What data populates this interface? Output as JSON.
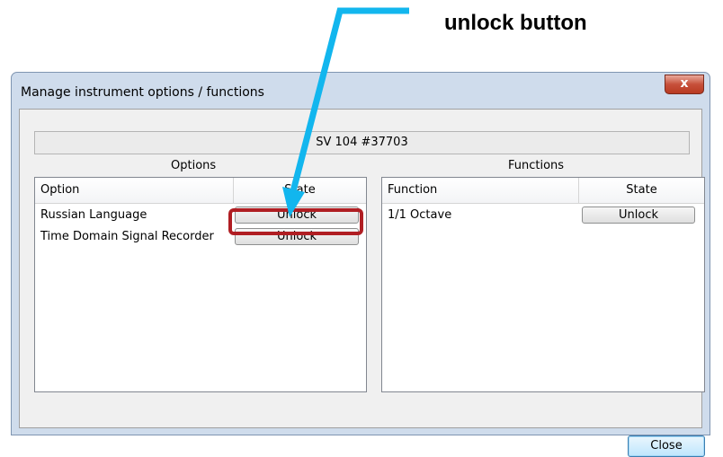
{
  "annotation": {
    "label": "unlock button"
  },
  "window": {
    "title": "Manage instrument options / functions",
    "close_glyph": "x",
    "device_id": "SV 104 #37703"
  },
  "options": {
    "group_label": "Options",
    "col_option": "Option",
    "col_state": "State",
    "rows": [
      {
        "name": "Russian Language",
        "button": "Unlock"
      },
      {
        "name": "Time Domain Signal Recorder",
        "button": "Unlock"
      }
    ]
  },
  "functions": {
    "group_label": "Functions",
    "col_function": "Function",
    "col_state": "State",
    "rows": [
      {
        "name": "1/1 Octave",
        "button": "Unlock"
      }
    ]
  },
  "buttons": {
    "close": "Close"
  },
  "colors": {
    "arrow": "#12b6ee",
    "highlight": "#b01e23"
  }
}
